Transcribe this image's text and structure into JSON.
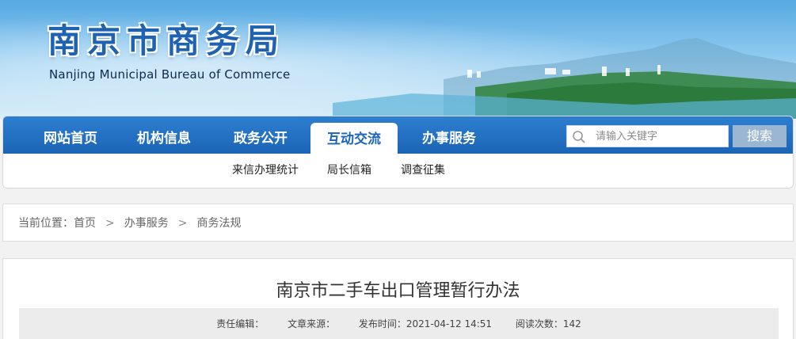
{
  "header": {
    "title": "南京市商务局",
    "subtitle": "Nanjing Municipal Bureau of Commerce"
  },
  "nav": {
    "items": [
      {
        "label": "网站首页"
      },
      {
        "label": "机构信息"
      },
      {
        "label": "政务公开"
      },
      {
        "label": "互动交流"
      },
      {
        "label": "办事服务"
      }
    ],
    "active": "互动交流",
    "subnav": [
      {
        "label": "来信办理统计"
      },
      {
        "label": "局长信箱"
      },
      {
        "label": "调查征集"
      }
    ]
  },
  "search": {
    "placeholder": "请输入关键字",
    "button_label": "搜索",
    "icon": "search-icon"
  },
  "breadcrumb": {
    "prefix": "当前位置：",
    "items": [
      "首页",
      "办事服务",
      "商务法规"
    ],
    "separator": ">"
  },
  "article": {
    "title": "南京市二手车出口管理暂行办法",
    "meta": {
      "editor": "责任编辑：",
      "source": "文章来源：",
      "publish_time": "发布时间：2021-04-12 14:51",
      "views": "阅读次数：142"
    }
  },
  "colors": {
    "nav_blue": "#1c64b6",
    "title_blue": "#1f63b0",
    "search_button": "#9bb6d3"
  }
}
